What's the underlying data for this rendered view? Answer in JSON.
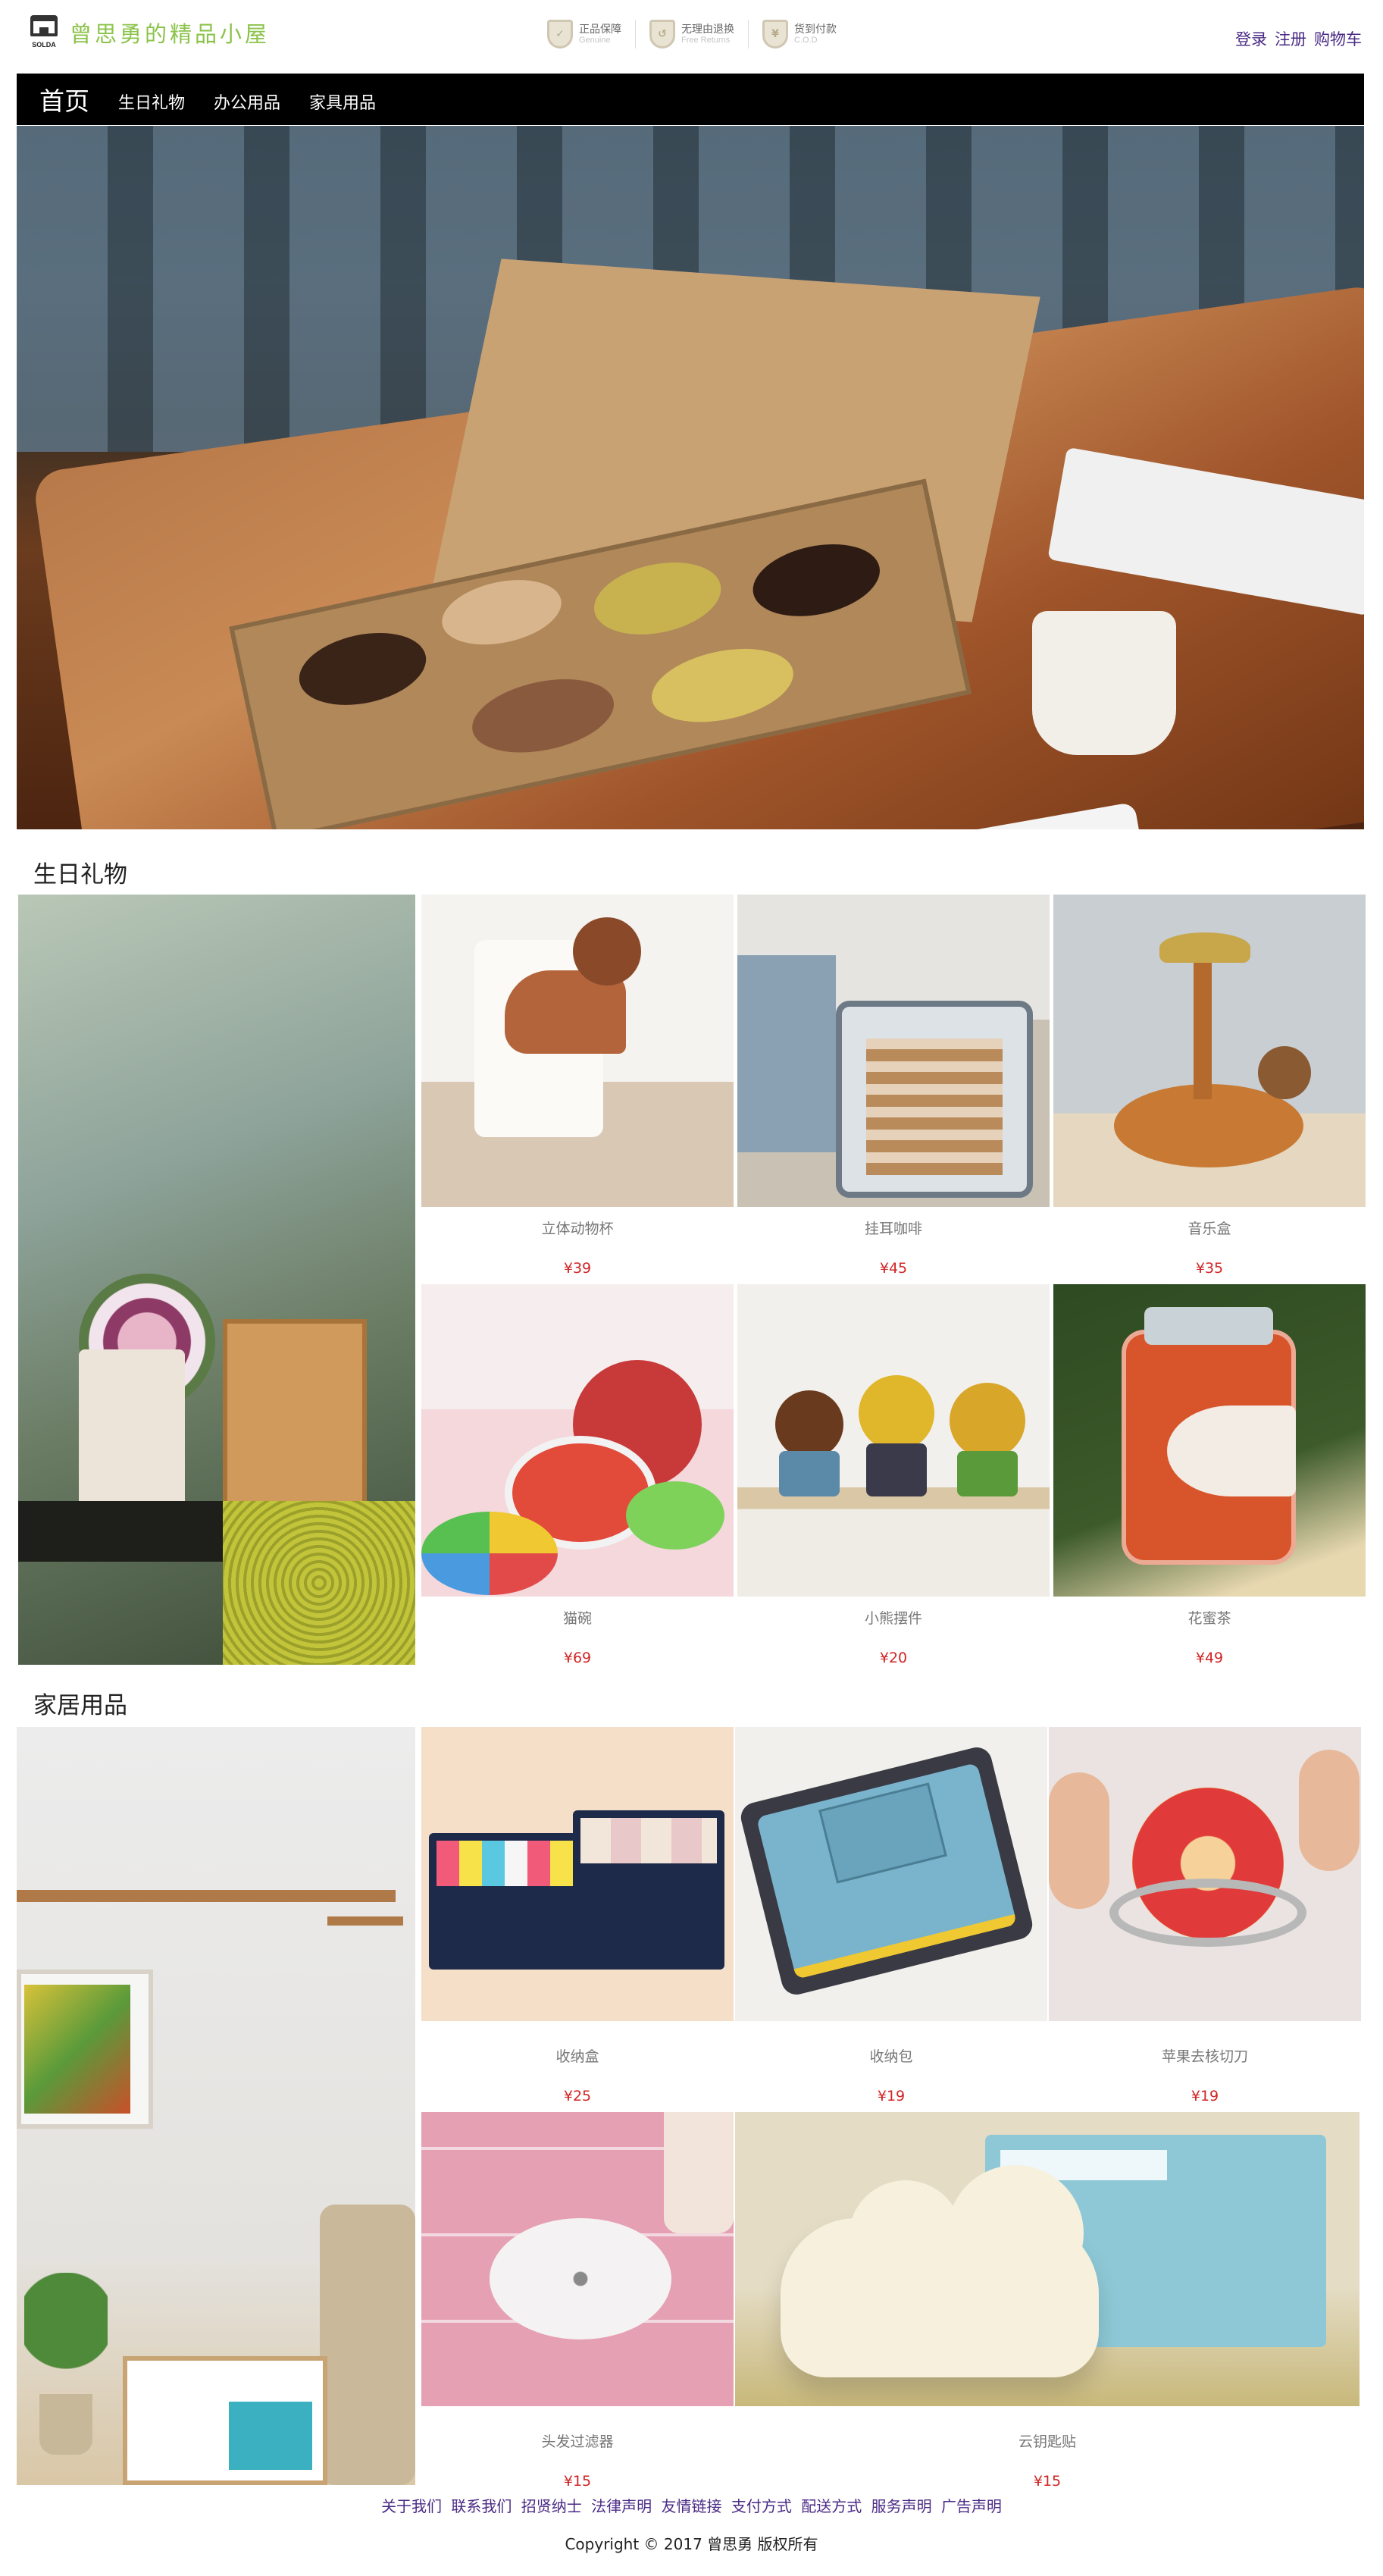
{
  "header": {
    "site_title": "曾思勇的精品小屋",
    "logo_word": "SOLDA",
    "badges": [
      {
        "cn": "正品保障",
        "en": "Genuine"
      },
      {
        "cn": "无理由退换",
        "en": "Free Returns"
      },
      {
        "cn": "货到付款",
        "en": "C.O.D"
      }
    ],
    "login": "登录",
    "register": "注册",
    "cart": "购物车"
  },
  "nav": {
    "home": "首页",
    "items": [
      "生日礼物",
      "办公用品",
      "家具用品"
    ]
  },
  "sections": [
    {
      "title": "生日礼物",
      "products": [
        {
          "name": "立体动物杯",
          "price": "¥39"
        },
        {
          "name": "挂耳咖啡",
          "price": "¥45"
        },
        {
          "name": "音乐盒",
          "price": "¥35"
        },
        {
          "name": "猫碗",
          "price": "¥69"
        },
        {
          "name": "小熊摆件",
          "price": "¥20"
        },
        {
          "name": "花蜜茶",
          "price": "¥49"
        }
      ]
    },
    {
      "title": "家居用品",
      "products": [
        {
          "name": "收纳盒",
          "price": "¥25"
        },
        {
          "name": "收纳包",
          "price": "¥19"
        },
        {
          "name": "苹果去核切刀",
          "price": "¥19"
        },
        {
          "name": "头发过滤器",
          "price": "¥15"
        },
        {
          "name": "云钥匙贴",
          "price": "¥15"
        }
      ]
    }
  ],
  "footer": {
    "links": [
      "关于我们",
      "联系我们",
      "招贤纳士",
      "法律声明",
      "友情链接",
      "支付方式",
      "配送方式",
      "服务声明",
      "广告声明"
    ],
    "copyright": "Copyright © 2017 曾思勇 版权所有"
  },
  "colors": {
    "accent_title": "#8bc34a",
    "link": "#4a2a86",
    "price": "#d12424",
    "nav_bg": "#000000"
  }
}
